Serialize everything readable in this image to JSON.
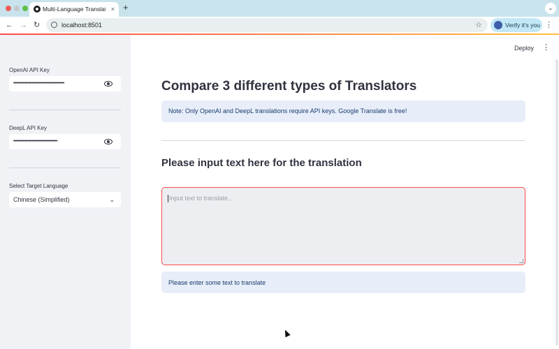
{
  "browser": {
    "tab_title": "Multi-Language Translation P",
    "tab_close": "×",
    "new_tab": "+",
    "url": "localhost:8501",
    "verify_label": "Verify it's you",
    "icons": [
      "back-arrow-icon",
      "forward-arrow-icon",
      "reload-icon",
      "site-info-icon",
      "star-icon",
      "kebab-menu-icon"
    ]
  },
  "sidebar": {
    "openai_label": "OpenAI API Key",
    "openai_value": "••••••••••••••••••••••••••••••••••••••••••••",
    "deepl_label": "DeepL API Key",
    "deepl_value": "••••••••••••••••••••••••••••••••••••••",
    "language_label": "Select Target Language",
    "language_value": "Chinese (Simplified)"
  },
  "header": {
    "deploy_label": "Deploy"
  },
  "main": {
    "title": "Compare 3 different types of Translators",
    "note": "Note: Only OpenAI and DeepL translations require API keys. Google Translate is free!",
    "section_title": "Please input text here for the translation",
    "input_placeholder": "Input text to translate...",
    "status": "Please enter some text to translate"
  },
  "colors": {
    "accent": "#ff4b4b",
    "sidebar_bg": "#f0f2f6",
    "info_bg": "#e7eef9",
    "info_text": "#1a3a6b"
  }
}
